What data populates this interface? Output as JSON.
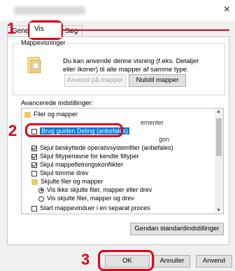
{
  "window": {
    "close_glyph": "×"
  },
  "tabs": [
    {
      "label": "Generel"
    },
    {
      "label": "Vis"
    },
    {
      "label": "Søg"
    }
  ],
  "folder_views": {
    "group_label": "Mappevisninger",
    "description": "Du kan anvende denne visning (f.eks. Detaljer eller Ikoner) til alle mapper af samme type.",
    "apply_button": "Anvend på mapper",
    "reset_button": "Nulstil mapper"
  },
  "advanced": {
    "label": "Avancerede indstillinger:",
    "items": [
      {
        "kind": "folder",
        "label": "Filer og mapper"
      },
      {
        "kind": "check",
        "checked": false,
        "label": "Brug guiden Deling (anbefales)",
        "highlighted": true
      },
      {
        "kind": "check",
        "checked": true,
        "label": "Skjul beskyttede operativsystemfiler (anbefales)"
      },
      {
        "kind": "check",
        "checked": true,
        "label": "Skjul filtypenavne for kendte filtyper"
      },
      {
        "kind": "check",
        "checked": true,
        "label": "Skjul mappefletningskonflikter"
      },
      {
        "kind": "check",
        "checked": false,
        "label": "Skjul tomme drev"
      },
      {
        "kind": "folder",
        "label": "Skjulte filer og mapper"
      },
      {
        "kind": "radio",
        "checked": true,
        "label": "Vis ikke skjulte filer, mapper eller drev"
      },
      {
        "kind": "radio",
        "checked": false,
        "label": "Vis skjulte filer, mapper og drev"
      },
      {
        "kind": "check",
        "checked": false,
        "label": "Start mappevinduer i en separat proces"
      }
    ],
    "partial_rows": [
      "ementer",
      "gon"
    ]
  },
  "buttons": {
    "restore_defaults": "Gendan standardindstillinger",
    "ok": "OK",
    "cancel": "Annuller",
    "apply": "Anvend"
  },
  "callouts": {
    "step1": "1",
    "step2": "2",
    "step3": "3"
  },
  "colors": {
    "callout": "#e2001a",
    "selection": "#0078d7"
  }
}
